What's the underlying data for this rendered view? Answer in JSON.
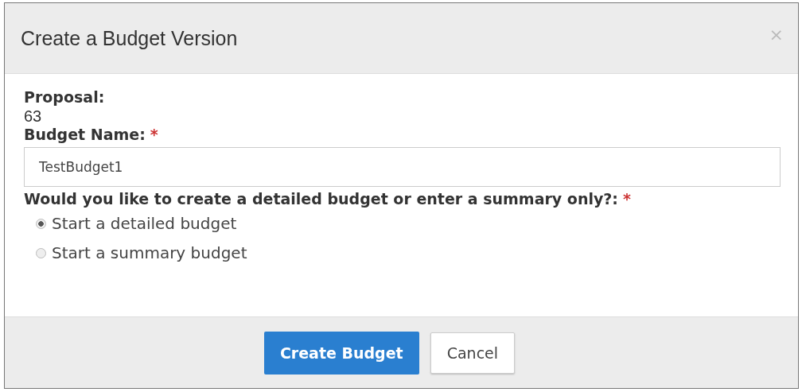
{
  "dialog": {
    "title": "Create a Budget Version",
    "close": "×"
  },
  "proposal": {
    "label": "Proposal:",
    "value": "63"
  },
  "budget_name": {
    "label": "Budget Name:",
    "required_mark": "*",
    "value": "TestBudget1"
  },
  "budget_type": {
    "label": "Would you like to create a detailed budget or enter a summary only?:",
    "required_mark": "*",
    "options": [
      {
        "label": "Start a detailed budget",
        "selected": true
      },
      {
        "label": "Start a summary budget",
        "selected": false
      }
    ]
  },
  "buttons": [
    {
      "label": "Create Budget",
      "kind": "primary"
    },
    {
      "label": "Cancel",
      "kind": "default"
    }
  ]
}
